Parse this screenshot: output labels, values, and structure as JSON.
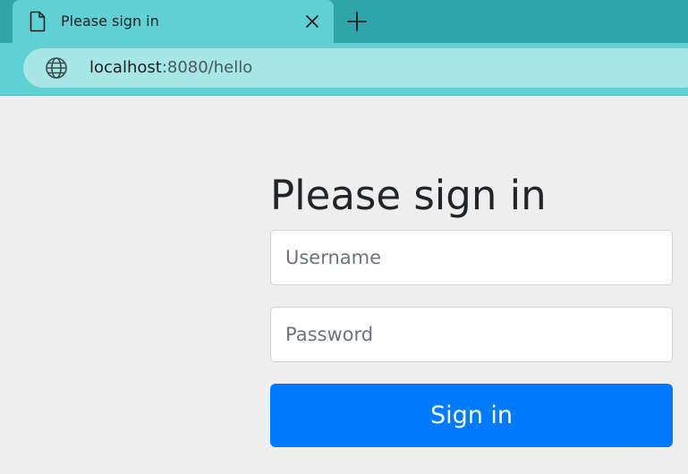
{
  "browser": {
    "tab": {
      "title": "Please sign in",
      "icon": "document-icon",
      "close_icon": "close-icon"
    },
    "new_tab_icon": "plus-icon",
    "address_bar": {
      "icon": "globe-icon",
      "host": "localhost",
      "path": ":8080/hello"
    },
    "colors": {
      "tabstrip": "#2ea6a9",
      "active_tab": "#5fd1d4",
      "omnibox": "#a7e6e6"
    }
  },
  "page": {
    "heading": "Please sign in",
    "username": {
      "placeholder": "Username",
      "value": ""
    },
    "password": {
      "placeholder": "Password",
      "value": ""
    },
    "submit_label": "Sign in",
    "colors": {
      "background": "#eeeeee",
      "button": "#007bff"
    }
  }
}
